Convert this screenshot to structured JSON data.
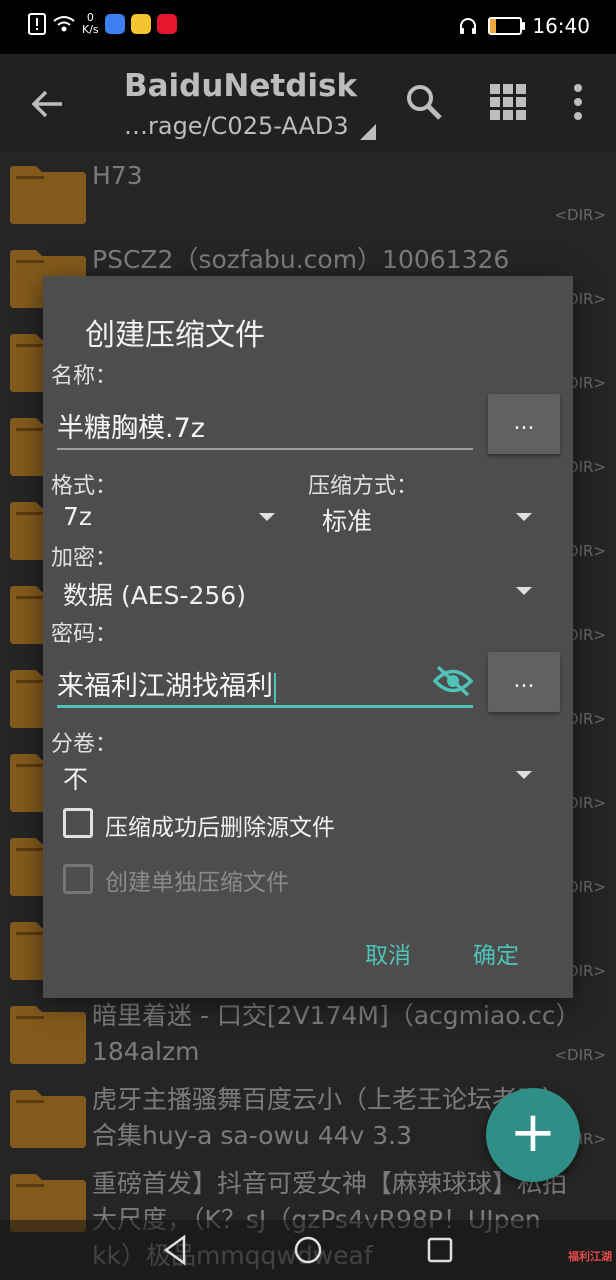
{
  "status_bar": {
    "speed_value": "0",
    "speed_unit": "K/s",
    "time": "16:40",
    "battery_percent": 20,
    "apps": [
      {
        "icon": "baidu-netdisk-icon",
        "color": "#3b7ff2"
      },
      {
        "icon": "app-icon",
        "color": "#f5c431"
      },
      {
        "icon": "weibo-icon",
        "color": "#e6162d"
      }
    ]
  },
  "app_bar": {
    "title": "BaiduNetdisk",
    "path": "…rage/C025-AAD3"
  },
  "file_list": [
    {
      "name": "H73",
      "tag": "<DIR>"
    },
    {
      "name": "PSCZ2（sozfabu.com）10061326",
      "tag": "<DIR>"
    },
    {
      "name": "",
      "tag": "<DIR>"
    },
    {
      "name": "",
      "tag": "<DIR>"
    },
    {
      "name": "",
      "tag": "<DIR>"
    },
    {
      "name": "",
      "tag": "<DIR>"
    },
    {
      "name": "",
      "tag": "<DIR>"
    },
    {
      "name": "",
      "tag": "<DIR>"
    },
    {
      "name": "",
      "tag": "<DIR>"
    },
    {
      "name": "",
      "tag": "<DIR>"
    },
    {
      "name": "暗里着迷 - 口交[2V174M]（acgmiao.cc）184alzm",
      "tag": "<DIR>"
    },
    {
      "name": "虎牙主播骚舞百度云小（上老王论坛老王）合集huy-a sa-owu 44v 3.3",
      "tag": "<DIR>"
    },
    {
      "name": "重磅首发】抖音可爱女神【麻辣球球】私拍大尺度，（K？sJ（gzPs4vR98P！UJpen kk）极品mmqqwdweaf",
      "tag": ""
    }
  ],
  "dialog": {
    "title": "创建压缩文件",
    "name_label": "名称：",
    "name_value": "半糖胸模.7z",
    "browse_label": "...",
    "format_label": "格式：",
    "format_value": "7z",
    "method_label": "压缩方式：",
    "method_value": "标准",
    "encryption_label": "加密：",
    "encryption_value": "数据 (AES-256)",
    "password_label": "密码：",
    "password_value": "来福利江湖找福利",
    "password_browse_label": "...",
    "split_label": "分卷：",
    "split_value": "不",
    "delete_source_label": "压缩成功后删除源文件",
    "delete_source_checked": false,
    "separate_label": "创建单独压缩文件",
    "separate_checked": false,
    "cancel_label": "取消",
    "ok_label": "确定"
  },
  "fab": {
    "label": "+"
  },
  "watermark": "福利江湖",
  "colors": {
    "accent": "#4fc3b7",
    "fab": "#2f8f86",
    "folder": "#c98a2c",
    "dialog_bg": "#4d4d4d"
  }
}
